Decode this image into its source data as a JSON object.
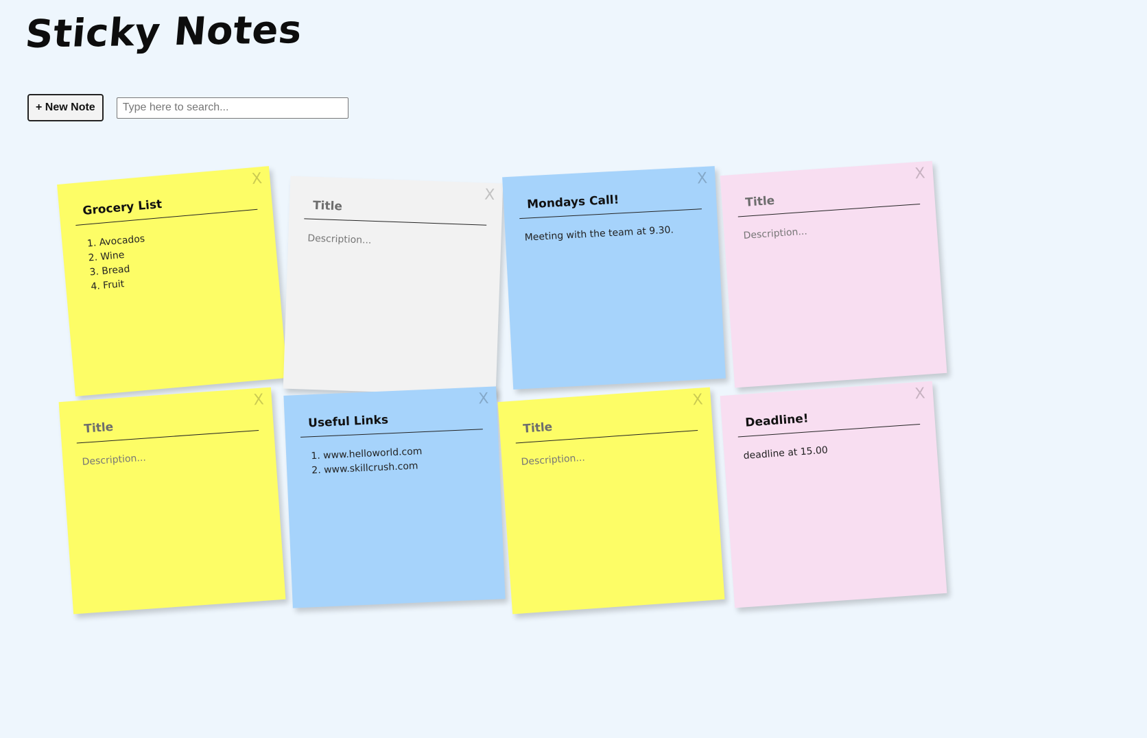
{
  "app": {
    "title": "Sticky Notes"
  },
  "toolbar": {
    "new_note_label": "+ New Note",
    "search_placeholder": "Type here to search..."
  },
  "placeholders": {
    "title": "Title",
    "description": "Description..."
  },
  "colors": {
    "yellow": "#fdfd66",
    "gray": "#f2f2f2",
    "blue": "#a6d3fb",
    "pink": "#f8def1",
    "background": "#eef6fd"
  },
  "icons": {
    "close": "close-icon"
  },
  "notes": [
    {
      "color": "yellow",
      "title": "Grocery List",
      "list": [
        "Avocados",
        "Wine",
        "Bread",
        "Fruit"
      ],
      "close_label": "X"
    },
    {
      "color": "gray",
      "title": "",
      "list": [],
      "description": "",
      "close_label": "X"
    },
    {
      "color": "blue",
      "title": "Mondays Call!",
      "description": "Meeting with the team at 9.30.",
      "close_label": "X"
    },
    {
      "color": "pink",
      "title": "",
      "description": "",
      "close_label": "X"
    },
    {
      "color": "yellow",
      "title": "",
      "description": "",
      "close_label": "X"
    },
    {
      "color": "blue",
      "title": "Useful Links",
      "list": [
        "www.helloworld.com",
        "www.skillcrush.com"
      ],
      "close_label": "X"
    },
    {
      "color": "yellow",
      "title": "",
      "description": "",
      "close_label": "X"
    },
    {
      "color": "pink",
      "title": "Deadline!",
      "description": "deadline at 15.00",
      "close_label": "X"
    }
  ]
}
